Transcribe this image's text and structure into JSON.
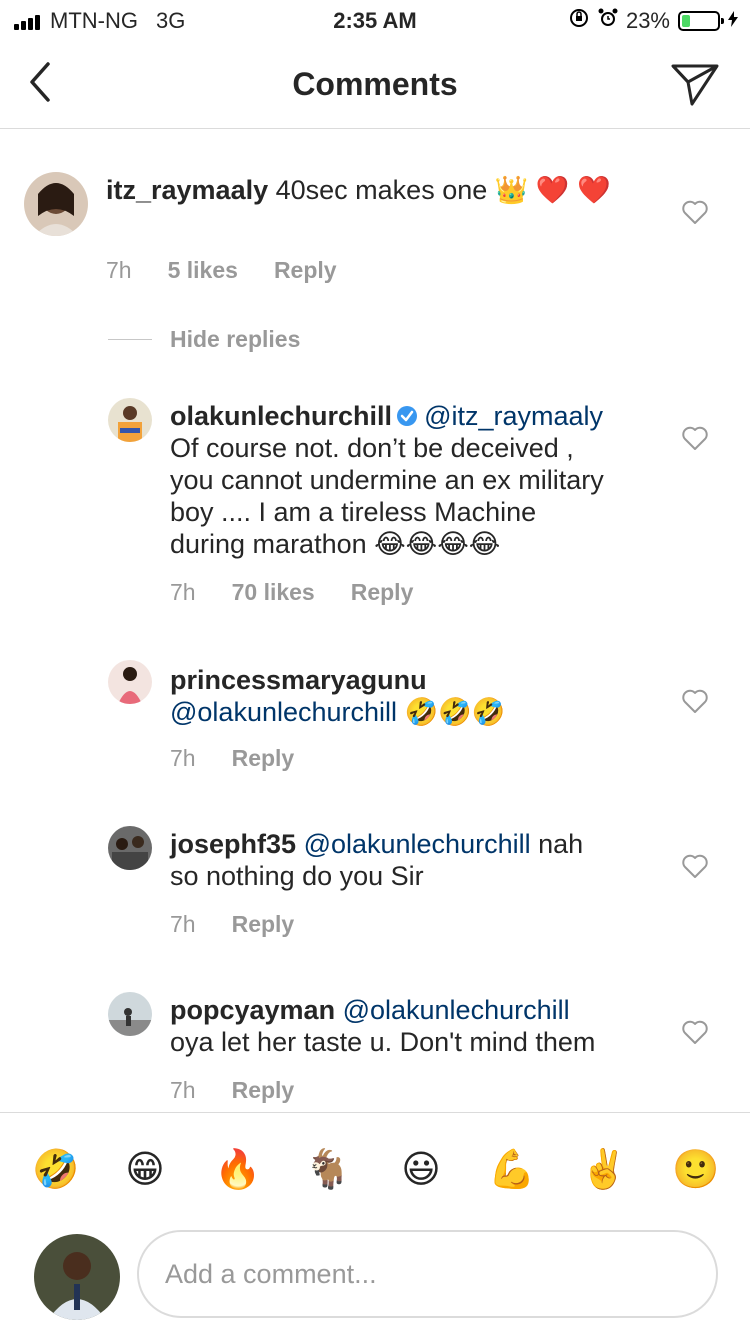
{
  "status_bar": {
    "carrier": "MTN-NG",
    "network": "3G",
    "time": "2:35 AM",
    "battery": "23%",
    "battery_level": 0.23,
    "icons": [
      "signal-icon",
      "rotation-lock-icon",
      "alarm-icon",
      "battery-icon",
      "charging-icon"
    ]
  },
  "header": {
    "title": "Comments",
    "back_icon": "chevron-left-icon",
    "share_icon": "paper-plane-icon"
  },
  "comments": [
    {
      "username": "itz_raymaaly",
      "text": "40sec makes one 👑 ❤️ ❤️",
      "time": "7h",
      "likes": "5 likes",
      "reply": "Reply"
    }
  ],
  "hide_replies": "Hide replies",
  "replies": [
    {
      "username": "olakunlechurchill",
      "verified": true,
      "mention": "@itz_raymaaly",
      "text_lines": [
        "Of course not.  don’t be deceived ,",
        "you cannot undermine an ex military",
        "boy .... I am a tireless Machine",
        "during marathon 😂😂😂😂"
      ],
      "time": "7h",
      "likes": "70 likes",
      "reply": "Reply"
    },
    {
      "username": "princessmaryagunu",
      "mention": "@olakunlechurchill",
      "text": "🤣🤣🤣",
      "time": "7h",
      "reply": "Reply"
    },
    {
      "username": "josephf35",
      "mention": "@olakunlechurchill",
      "text_inline": "nah",
      "text_line2": "so nothing do you Sir",
      "time": "7h",
      "reply": "Reply"
    },
    {
      "username": "popcyayman",
      "mention": "@olakunlechurchill",
      "text_line2": "oya let her taste u. Don't mind them",
      "time": "7h",
      "reply": "Reply"
    }
  ],
  "emoji_bar": [
    "🤣",
    "😁",
    "🔥",
    "🐐",
    "😃",
    "💪",
    "✌️",
    "🙂"
  ],
  "input": {
    "placeholder": "Add a comment..."
  },
  "colors": {
    "mention": "#003569",
    "meta": "#999999",
    "divider": "#dbdbdb",
    "verified": "#3897f0",
    "battery": "#4cd964"
  }
}
